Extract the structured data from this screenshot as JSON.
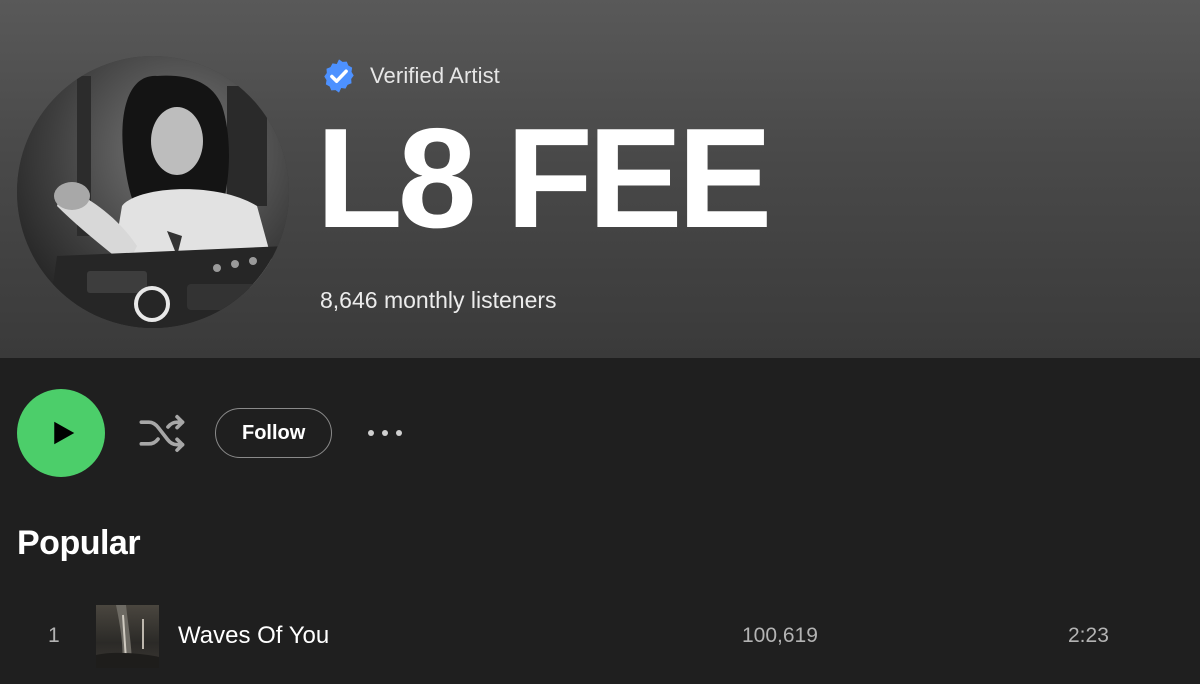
{
  "artist": {
    "verified_label": "Verified Artist",
    "name": "L8 FEE",
    "monthly_listeners": "8,646 monthly listeners",
    "avatar_icon": "artist-photo"
  },
  "actions": {
    "play_icon": "play-icon",
    "shuffle_icon": "shuffle-icon",
    "follow_label": "Follow",
    "more_icon": "more-options-icon",
    "accent_color": "#1ed760"
  },
  "popular": {
    "title": "Popular",
    "tracks": [
      {
        "number": "1",
        "title": "Waves Of You",
        "plays": "100,619",
        "duration": "2:23"
      }
    ]
  }
}
